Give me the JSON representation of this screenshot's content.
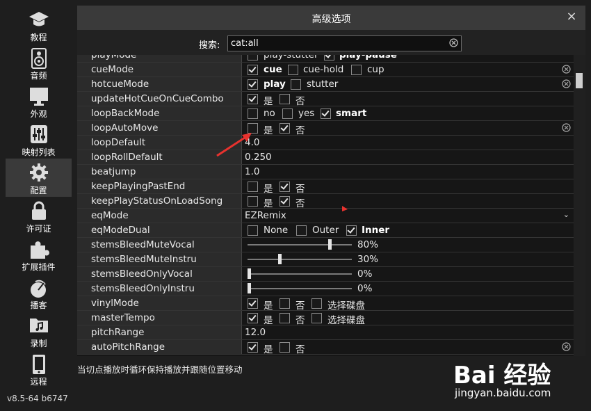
{
  "sidebar": {
    "items": [
      {
        "label": "教程",
        "icon": "graduation-cap-icon"
      },
      {
        "label": "音频",
        "icon": "speaker-icon"
      },
      {
        "label": "外观",
        "icon": "monitor-icon"
      },
      {
        "label": "映射列表",
        "icon": "sliders-icon"
      },
      {
        "label": "配置",
        "icon": "gear-icon"
      },
      {
        "label": "许可证",
        "icon": "lock-icon"
      },
      {
        "label": "扩展插件",
        "icon": "puzzle-icon"
      },
      {
        "label": "播客",
        "icon": "podcast-icon"
      },
      {
        "label": "录制",
        "icon": "music-folder-icon"
      },
      {
        "label": "远程",
        "icon": "tablet-icon"
      }
    ],
    "active": "配置",
    "version": "v8.5-64 b6747"
  },
  "dialog": {
    "title": "高级选项",
    "close": "×",
    "search_label": "搜索:",
    "search_value": "cat:all"
  },
  "rows": {
    "r0": {
      "name": "playMode",
      "o1": "play-stutter",
      "o2": "play-pause"
    },
    "r1": {
      "name": "cueMode",
      "o1": "cue",
      "o2": "cue-hold",
      "o3": "cup"
    },
    "r2": {
      "name": "hotcueMode",
      "o1": "play",
      "o2": "stutter"
    },
    "r3": {
      "name": "updateHotCueOnCueCombo",
      "o1": "是",
      "o2": "否"
    },
    "r4": {
      "name": "loopBackMode",
      "o1": "no",
      "o2": "yes",
      "o3": "smart"
    },
    "r5": {
      "name": "loopAutoMove",
      "o1": "是",
      "o2": "否"
    },
    "r6": {
      "name": "loopDefault",
      "value": "4.0"
    },
    "r7": {
      "name": "loopRollDefault",
      "value": "0.250"
    },
    "r8": {
      "name": "beatjump",
      "value": "1.0"
    },
    "r9": {
      "name": "keepPlayingPastEnd",
      "o1": "是",
      "o2": "否"
    },
    "r10": {
      "name": "keepPlayStatusOnLoadSong",
      "o1": "是",
      "o2": "否"
    },
    "r11": {
      "name": "eqMode",
      "value": "EZRemix",
      "arrow": "⌄"
    },
    "r12": {
      "name": "eqModeDual",
      "o1": "None",
      "o2": "Outer",
      "o3": "Inner"
    },
    "r13": {
      "name": "stemsBleedMuteVocal",
      "pct": "80%",
      "level": 0.8
    },
    "r14": {
      "name": "stemsBleedMuteInstru",
      "pct": "30%",
      "level": 0.3
    },
    "r15": {
      "name": "stemsBleedOnlyVocal",
      "pct": "0%",
      "level": 0
    },
    "r16": {
      "name": "stemsBleedOnlyInstru",
      "pct": "0%",
      "level": 0
    },
    "r17": {
      "name": "vinylMode",
      "o1": "是",
      "o2": "否",
      "o3": "选择碟盘"
    },
    "r18": {
      "name": "masterTempo",
      "o1": "是",
      "o2": "否",
      "o3": "选择碟盘"
    },
    "r19": {
      "name": "pitchRange",
      "value": "12.0"
    },
    "r20": {
      "name": "autoPitchRange",
      "o1": "是",
      "o2": "否"
    }
  },
  "description": "当切点播放时循环保持播放并跟随位置移动",
  "watermark": {
    "brand": "Bai 经验",
    "url": "jingyan.baidu.com"
  },
  "colors": {
    "annotation": "#e8322e",
    "accent": "#3a3a3a"
  }
}
